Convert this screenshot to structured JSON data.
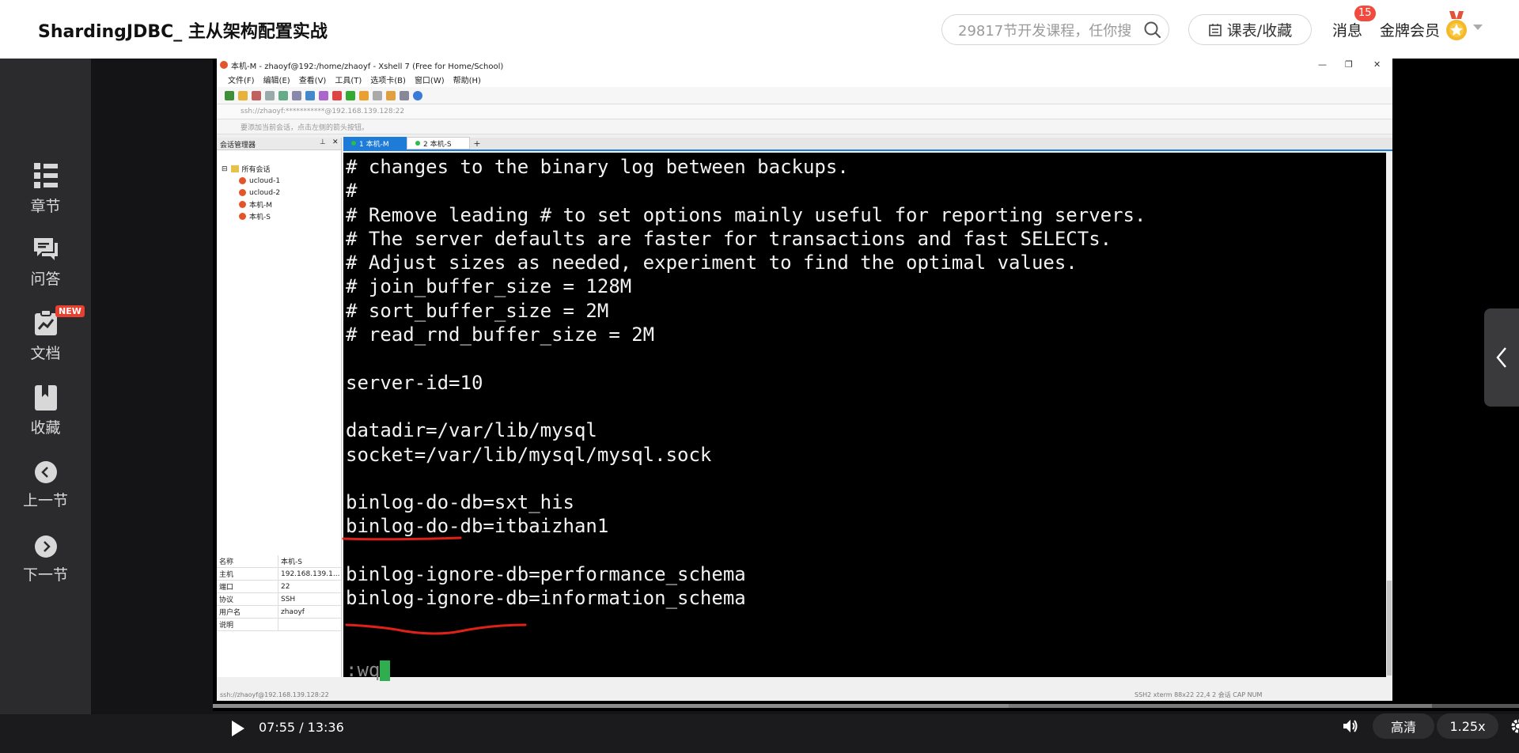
{
  "header": {
    "course_title": "ShardingJDBC_ 主从架构配置实战",
    "search_placeholder": "29817节开发课程，任你搜",
    "schedule_label": "课表/收藏",
    "messages_label": "消息",
    "messages_count": "15",
    "vip_label": "金牌会员"
  },
  "sidebar": {
    "items": [
      {
        "label": "章节",
        "icon": "chapters-icon"
      },
      {
        "label": "问答",
        "icon": "qa-icon"
      },
      {
        "label": "文档",
        "icon": "docs-icon",
        "badge": "NEW"
      },
      {
        "label": "收藏",
        "icon": "bookmark-icon"
      },
      {
        "label": "上一节",
        "icon": "prev-icon"
      },
      {
        "label": "下一节",
        "icon": "next-icon"
      }
    ]
  },
  "xshell": {
    "title": "本机-M - zhaoyf@192:/home/zhaoyf - Xshell 7 (Free for Home/School)",
    "menu": [
      "文件(F)",
      "编辑(E)",
      "查看(V)",
      "工具(T)",
      "选项卡(B)",
      "窗口(W)",
      "帮助(H)"
    ],
    "address": "ssh://zhaoyf:***********@192.168.139.128:22",
    "hint": "要添加当前会话，点击左侧的箭头按钮。",
    "session_manager": "会话管理器",
    "tree": [
      "所有会话",
      "ucloud-1",
      "ucloud-2",
      "本机-M",
      "本机-S"
    ],
    "tabs": [
      "1 本机-M",
      "2 本机-S"
    ],
    "properties": [
      {
        "k": "名称",
        "v": "本机-S"
      },
      {
        "k": "主机",
        "v": "192.168.139.1..."
      },
      {
        "k": "端口",
        "v": "22"
      },
      {
        "k": "协议",
        "v": "SSH"
      },
      {
        "k": "用户名",
        "v": "zhaoyf"
      },
      {
        "k": "说明",
        "v": ""
      }
    ],
    "status_left": "ssh://zhaoyf@192.168.139.128:22",
    "status_right": "SSH2    xterm    88x22    22,4    2 会话    CAP  NUM"
  },
  "terminal": {
    "lines": [
      "# changes to the binary log between backups.",
      "#",
      "# Remove leading # to set options mainly useful for reporting servers.",
      "# The server defaults are faster for transactions and fast SELECTs.",
      "# Adjust sizes as needed, experiment to find the optimal values.",
      "# join_buffer_size = 128M",
      "# sort_buffer_size = 2M",
      "# read_rnd_buffer_size = 2M",
      "",
      "server-id=10",
      "",
      "datadir=/var/lib/mysql",
      "socket=/var/lib/mysql/mysql.sock",
      "",
      "binlog-do-db=sxt_his",
      "binlog-do-db=itbaizhan1",
      "",
      "binlog-ignore-db=performance_schema",
      "binlog-ignore-db=information_schema",
      "",
      "",
      ":wq"
    ]
  },
  "player": {
    "time": "07:55 / 13:36",
    "quality": "高清",
    "speed": "1.25x",
    "played_fraction": 0.582,
    "buffered_fraction": 0.892
  },
  "colors": {
    "accent_blue": "#1e7bd8",
    "badge_red": "#f04b3e",
    "annotation_red": "#e0201a"
  }
}
